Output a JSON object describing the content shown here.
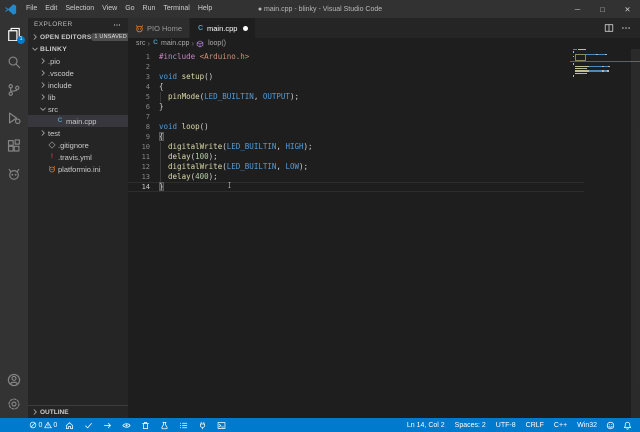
{
  "title_bar": {
    "title": "● main.cpp - blinky - Visual Studio Code",
    "menus": [
      "File",
      "Edit",
      "Selection",
      "View",
      "Go",
      "Run",
      "Terminal",
      "Help"
    ],
    "window_controls": [
      {
        "name": "minimize",
        "glyph": "─"
      },
      {
        "name": "maximize",
        "glyph": "□"
      },
      {
        "name": "close",
        "glyph": "✕"
      }
    ]
  },
  "activity_bar": {
    "items": [
      {
        "name": "explorer",
        "icon": "files",
        "active": true,
        "badge": "1"
      },
      {
        "name": "search",
        "icon": "search"
      },
      {
        "name": "source-control",
        "icon": "git-branch"
      },
      {
        "name": "run-debug",
        "icon": "debug"
      },
      {
        "name": "extensions",
        "icon": "extensions"
      },
      {
        "name": "platformio",
        "icon": "alien"
      }
    ],
    "bottom": [
      {
        "name": "account",
        "icon": "account"
      },
      {
        "name": "settings",
        "icon": "gear"
      }
    ]
  },
  "sidebar": {
    "header": "EXPLORER",
    "open_editors": {
      "label": "OPEN EDITORS",
      "badge": "1 UNSAVED"
    },
    "tree": [
      {
        "label": "BLINKY",
        "level": 0,
        "chevron": "down",
        "bold": true
      },
      {
        "label": ".pio",
        "level": 1,
        "chevron": "right"
      },
      {
        "label": ".vscode",
        "level": 1,
        "chevron": "right"
      },
      {
        "label": "include",
        "level": 1,
        "chevron": "right"
      },
      {
        "label": "lib",
        "level": 1,
        "chevron": "right"
      },
      {
        "label": "src",
        "level": 1,
        "chevron": "down"
      },
      {
        "label": "main.cpp",
        "level": 2,
        "icon": "cpp",
        "selected": true
      },
      {
        "label": "test",
        "level": 1,
        "chevron": "right"
      },
      {
        "label": ".gitignore",
        "level": 1,
        "icon": "git"
      },
      {
        "label": ".travis.yml",
        "level": 1,
        "icon": "travis"
      },
      {
        "label": "platformio.ini",
        "level": 1,
        "icon": "pio"
      }
    ],
    "outline": "OUTLINE"
  },
  "tabs": [
    {
      "label": "PIO Home",
      "icon": "pio",
      "active": false,
      "modified": false
    },
    {
      "label": "main.cpp",
      "icon": "cpp",
      "active": true,
      "modified": true
    }
  ],
  "editor_actions": [
    {
      "name": "split-editor",
      "icon": "split"
    },
    {
      "name": "more-actions",
      "icon": "ellipsis"
    }
  ],
  "breadcrumb": {
    "items": [
      {
        "label": "src"
      },
      {
        "label": "main.cpp",
        "icon": "cpp"
      },
      {
        "label": "loop()",
        "icon": "method"
      }
    ]
  },
  "code": {
    "language": "cpp",
    "lines": [
      {
        "n": 1,
        "tokens": [
          [
            "pp",
            "#include"
          ],
          [
            "pl",
            " "
          ],
          [
            "str",
            "<Arduino.h>"
          ]
        ]
      },
      {
        "n": 2,
        "tokens": []
      },
      {
        "n": 3,
        "tokens": [
          [
            "kw",
            "void"
          ],
          [
            "pl",
            " "
          ],
          [
            "fn",
            "setup"
          ],
          [
            "pl",
            "()"
          ]
        ]
      },
      {
        "n": 4,
        "tokens": [
          [
            "pl",
            "{"
          ]
        ]
      },
      {
        "n": 5,
        "g": true,
        "tokens": [
          [
            "pl",
            "  "
          ],
          [
            "fn",
            "pinMode"
          ],
          [
            "pl",
            "("
          ],
          [
            "mac",
            "LED_BUILTIN"
          ],
          [
            "pl",
            ", "
          ],
          [
            "mac",
            "OUTPUT"
          ],
          [
            "pl",
            ");"
          ]
        ]
      },
      {
        "n": 6,
        "tokens": [
          [
            "pl",
            "}"
          ]
        ]
      },
      {
        "n": 7,
        "tokens": []
      },
      {
        "n": 8,
        "tokens": [
          [
            "kw",
            "void"
          ],
          [
            "pl",
            " "
          ],
          [
            "fn",
            "loop"
          ],
          [
            "pl",
            "()"
          ]
        ]
      },
      {
        "n": 9,
        "tokens": [
          [
            "pl",
            "{",
            "m"
          ]
        ]
      },
      {
        "n": 10,
        "g": true,
        "tokens": [
          [
            "pl",
            "  "
          ],
          [
            "fn",
            "digitalWrite"
          ],
          [
            "pl",
            "("
          ],
          [
            "mac",
            "LED_BUILTIN"
          ],
          [
            "pl",
            ", "
          ],
          [
            "mac",
            "HIGH"
          ],
          [
            "pl",
            ");"
          ]
        ]
      },
      {
        "n": 11,
        "g": true,
        "tokens": [
          [
            "pl",
            "  "
          ],
          [
            "fn",
            "delay"
          ],
          [
            "pl",
            "("
          ],
          [
            "num",
            "100"
          ],
          [
            "pl",
            ");"
          ]
        ]
      },
      {
        "n": 12,
        "g": true,
        "tokens": [
          [
            "pl",
            "  "
          ],
          [
            "fn",
            "digitalWrite"
          ],
          [
            "pl",
            "("
          ],
          [
            "mac",
            "LED_BUILTIN"
          ],
          [
            "pl",
            ", "
          ],
          [
            "mac",
            "LOW"
          ],
          [
            "pl",
            ");"
          ]
        ]
      },
      {
        "n": 13,
        "g": true,
        "tokens": [
          [
            "pl",
            "  "
          ],
          [
            "fn",
            "delay"
          ],
          [
            "pl",
            "("
          ],
          [
            "num",
            "400"
          ],
          [
            "pl",
            ");"
          ]
        ]
      },
      {
        "n": 14,
        "current": true,
        "tokens": [
          [
            "pl",
            "}",
            "m"
          ]
        ]
      }
    ]
  },
  "status_bar": {
    "problems": {
      "errors": "0",
      "warnings": "0"
    },
    "pio_buttons": [
      {
        "name": "pio-home",
        "icon": "home"
      },
      {
        "name": "pio-build",
        "icon": "check"
      },
      {
        "name": "pio-upload",
        "icon": "arrow-right"
      },
      {
        "name": "pio-remote",
        "icon": "eye"
      },
      {
        "name": "pio-clean",
        "icon": "trash"
      },
      {
        "name": "pio-test",
        "icon": "flask"
      },
      {
        "name": "pio-project-tasks",
        "icon": "tasks"
      },
      {
        "name": "pio-serial-monitor",
        "icon": "plug"
      },
      {
        "name": "pio-new-terminal",
        "icon": "terminal"
      }
    ],
    "right_items": [
      "Ln 14, Col 2",
      "Spaces: 2",
      "UTF-8",
      "CRLF",
      "C++",
      "Win32"
    ],
    "right_icons": [
      {
        "name": "feedback",
        "icon": "smiley"
      },
      {
        "name": "notifications",
        "icon": "bell"
      }
    ]
  },
  "colors": {
    "accent": "#007acc",
    "titlebar": "#323233",
    "activitybar": "#333333",
    "sidebar": "#252526",
    "editor": "#1e1e1e",
    "tab_inactive": "#2d2d2d",
    "statusbar": "#007acc",
    "pio_orange": "#f58220",
    "cpp_blue": "#519aba",
    "travis_red": "#cc3e44",
    "git_gray": "#8c8c8c",
    "method_purple": "#b180d7",
    "syntax": {
      "pp": "#c586c0",
      "str": "#ce9178",
      "kw": "#569cd6",
      "fn": "#dcdcaa",
      "mac": "#569cd6",
      "num": "#b5cea8",
      "pl": "#d4d4d4"
    }
  }
}
